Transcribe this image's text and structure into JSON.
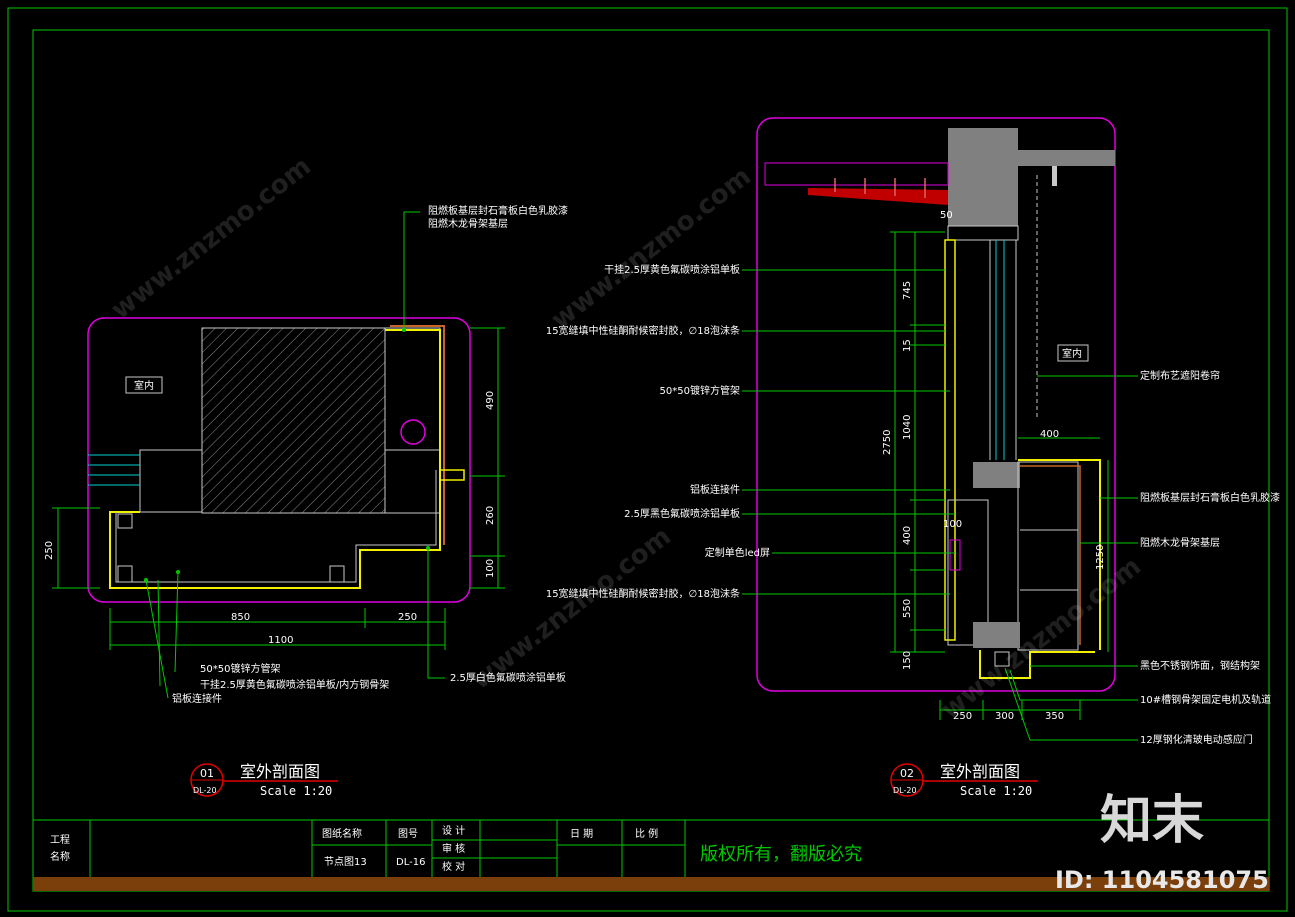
{
  "drawing1": {
    "room_label": "室内",
    "notes": {
      "top1": "阻燃板基层封石膏板白色乳胶漆",
      "top2": "阻燃木龙骨架基层",
      "bl1": "50*50镀锌方管架",
      "bl2": "干挂2.5厚黄色氟碳喷涂铝单板/内方钢骨架",
      "bl3": "铝板连接件",
      "br1": "2.5厚白色氟碳喷涂铝单板"
    },
    "dims": {
      "h1": "850",
      "h2": "250",
      "h3": "1100",
      "v_left": "250",
      "v1": "490",
      "v2": "260",
      "v3": "100"
    },
    "caption": {
      "num": "01",
      "ref": "DL-20",
      "title": "室外剖面图",
      "scale": "Scale 1:20"
    }
  },
  "drawing2": {
    "room_label": "室内",
    "notes": {
      "l1": "干挂2.5厚黄色氟碳喷涂铝单板",
      "l2": "15宽缝填中性硅酮耐候密封胶，∅18泡沫条",
      "l3": "50*50镀锌方管架",
      "l4": "铝板连接件",
      "l5": "2.5厚黑色氟碳喷涂铝单板",
      "l6": "定制单色led屏",
      "l7": "15宽缝填中性硅酮耐候密封胶，∅18泡沫条",
      "r1": "定制布艺遮阳卷帘",
      "r2": "阻燃板基层封石膏板白色乳胶漆",
      "r3": "阻燃木龙骨架基层",
      "r4": "黑色不锈钢饰面，钢结构架",
      "r5": "10#槽钢骨架固定电机及轨道",
      "r6": "12厚钢化清玻电动感应门"
    },
    "dims": {
      "d50": "50",
      "d745": "745",
      "d15": "15",
      "d1040": "1040",
      "d2750": "2750",
      "d400": "400",
      "d100": "100",
      "d400b": "400",
      "d550": "550",
      "d150": "150",
      "d1250": "1250",
      "b250": "250",
      "b300": "300",
      "b350": "350"
    },
    "caption": {
      "num": "02",
      "ref": "DL-20",
      "title": "室外剖面图",
      "scale": "Scale 1:20"
    }
  },
  "title_block": {
    "project_l1": "工程",
    "project_l2": "名称",
    "drawing_name_label": "图纸名称",
    "drawing_name": "节点图13",
    "number_label": "图号",
    "number": "DL-16",
    "design": "设 计",
    "review": "审 核",
    "check": "校 对",
    "date": "日 期",
    "scale": "比 例",
    "copyright": "版权所有，翻版必究"
  },
  "watermark": {
    "site": "www.znzmo.com",
    "brand": "知末",
    "id": "ID: 1104581075"
  },
  "colors": {
    "frame": "#00c800",
    "magenta": "#e000e0",
    "yellow": "#f0f000",
    "cyan": "#00d0d0",
    "gray": "#808080",
    "footer_bar": "#7a3f0a",
    "copyright": "#00c800"
  }
}
